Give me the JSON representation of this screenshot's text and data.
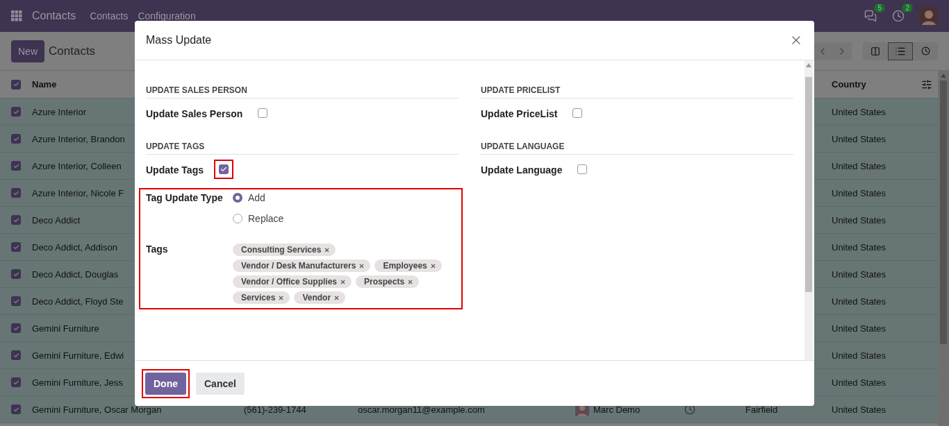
{
  "navbar": {
    "app_name": "Contacts",
    "menu": [
      "Contacts",
      "Configuration"
    ],
    "messages_badge": "5",
    "activities_badge": "2"
  },
  "control_panel": {
    "new_button": "New",
    "title": "Contacts"
  },
  "list": {
    "header_checked": true,
    "columns": {
      "name": "Name",
      "country": "Country"
    },
    "rows": [
      {
        "name": "Azure Interior",
        "country": "United States",
        "selected": true
      },
      {
        "name": "Azure Interior, Brandon",
        "country": "United States",
        "selected": true
      },
      {
        "name": "Azure Interior, Colleen",
        "country": "United States",
        "selected": true
      },
      {
        "name": "Azure Interior, Nicole F",
        "country": "United States",
        "selected": true
      },
      {
        "name": "Deco Addict",
        "country": "United States",
        "selected": true
      },
      {
        "name": "Deco Addict, Addison",
        "country": "United States",
        "selected": true
      },
      {
        "name": "Deco Addict, Douglas",
        "country": "United States",
        "selected": true
      },
      {
        "name": "Deco Addict, Floyd Ste",
        "country": "United States",
        "selected": true
      },
      {
        "name": "Gemini Furniture",
        "country": "United States",
        "selected": true
      },
      {
        "name": "Gemini Furniture, Edwi",
        "country": "United States",
        "selected": true
      },
      {
        "name": "Gemini Furniture, Jess",
        "country": "United States",
        "selected": true
      },
      {
        "name": "Gemini Furniture, Oscar Morgan",
        "phone": "(561)-239-1744",
        "email": "oscar.morgan11@example.com",
        "salesperson": "Marc Demo",
        "city": "Fairfield",
        "country": "United States",
        "selected": true
      }
    ]
  },
  "modal": {
    "title": "Mass Update",
    "left_column": [
      {
        "heading": "UPDATE SALES PERSON",
        "fields": [
          {
            "kind": "checkbox",
            "label": "Update Sales Person",
            "checked": false,
            "highlighted": false
          }
        ]
      },
      {
        "heading": "UPDATE TAGS",
        "fields": [
          {
            "kind": "checkbox",
            "label": "Update Tags",
            "checked": true,
            "highlighted": true
          }
        ],
        "highlighted_fields": [
          {
            "kind": "radio",
            "label": "Tag Update Type",
            "options": [
              {
                "label": "Add",
                "selected": true
              },
              {
                "label": "Replace",
                "selected": false
              }
            ]
          },
          {
            "kind": "tags",
            "label": "Tags",
            "tags": [
              "Consulting Services",
              "Vendor / Desk Manufacturers",
              "Employees",
              "Vendor / Office Supplies",
              "Prospects",
              "Services",
              "Vendor"
            ]
          }
        ]
      }
    ],
    "right_column": [
      {
        "heading": "UPDATE PRICELIST",
        "fields": [
          {
            "kind": "checkbox",
            "label": "Update PriceList",
            "checked": false,
            "highlighted": false
          }
        ]
      },
      {
        "heading": "UPDATE LANGUAGE",
        "fields": [
          {
            "kind": "checkbox",
            "label": "Update Language",
            "checked": false,
            "highlighted": false
          }
        ]
      }
    ],
    "buttons": [
      {
        "label": "Done",
        "kind": "primary",
        "highlighted": true
      },
      {
        "label": "Cancel",
        "kind": "secondary",
        "highlighted": false
      }
    ]
  }
}
